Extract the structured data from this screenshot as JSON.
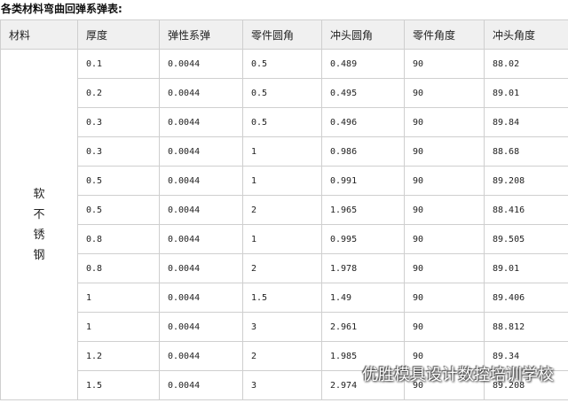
{
  "title": "各类材料弯曲回弹系弹表:",
  "table": {
    "headers": [
      "材料",
      "厚度",
      "弹性系弹",
      "零件圆角",
      "冲头圆角",
      "零件角度",
      "冲头角度"
    ],
    "material": [
      "软",
      "不",
      "锈",
      "钢"
    ],
    "rows": [
      [
        "0.1",
        "0.0044",
        "0.5",
        "0.489",
        "90",
        "88.02"
      ],
      [
        "0.2",
        "0.0044",
        "0.5",
        "0.495",
        "90",
        "89.01"
      ],
      [
        "0.3",
        "0.0044",
        "0.5",
        "0.496",
        "90",
        "89.84"
      ],
      [
        "0.3",
        "0.0044",
        "1",
        "0.986",
        "90",
        "88.68"
      ],
      [
        "0.5",
        "0.0044",
        "1",
        "0.991",
        "90",
        "89.208"
      ],
      [
        "0.5",
        "0.0044",
        "2",
        "1.965",
        "90",
        "88.416"
      ],
      [
        "0.8",
        "0.0044",
        "1",
        "0.995",
        "90",
        "89.505"
      ],
      [
        "0.8",
        "0.0044",
        "2",
        "1.978",
        "90",
        "89.01"
      ],
      [
        "1",
        "0.0044",
        "1.5",
        "1.49",
        "90",
        "89.406"
      ],
      [
        "1",
        "0.0044",
        "3",
        "2.961",
        "90",
        "88.812"
      ],
      [
        "1.2",
        "0.0044",
        "2",
        "1.985",
        "90",
        "89.34"
      ],
      [
        "1.5",
        "0.0044",
        "3",
        "2.974",
        "90",
        "89.208"
      ]
    ]
  },
  "watermark": "优胜模具设计数控培训学校"
}
